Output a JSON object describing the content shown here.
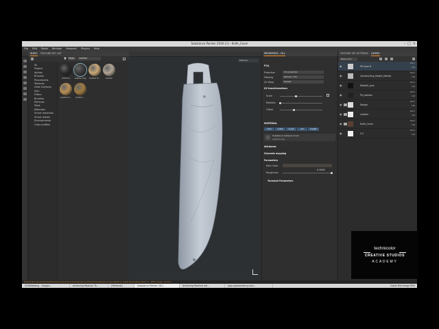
{
  "window": {
    "title": "Substance Painter 2019.3.3 - Knife_Cover"
  },
  "menu": [
    "File",
    "Edit",
    "Mode",
    "Window",
    "Viewport",
    "Plugins",
    "Help"
  ],
  "shelf": {
    "tabs": [
      "SHELF",
      "TEXTURE SET LIST"
    ],
    "filter_chip": "Mate",
    "search_value": "Leather",
    "categories": [
      "All",
      "Project",
      "Alphas",
      "Brushes",
      "Procedurals",
      "Textures",
      "Hard Surfaces",
      "Skin",
      "Filters",
      "Brushes",
      "Particles",
      "Tools",
      "Materials",
      "Smart materials",
      "Smart masks",
      "Environments",
      "Color profiles"
    ],
    "materials": [
      {
        "label": "Artificial",
        "color": "#2a2a2a"
      },
      {
        "label": "Leather bag",
        "color": "#3a3a3a"
      },
      {
        "label": "Leather B...",
        "color": "#c9a979"
      },
      {
        "label": "Leather",
        "color": "#b0a494"
      },
      {
        "label": "Leather R...",
        "color": "#b88f55"
      },
      {
        "label": "Leather ...",
        "color": "#a07a40"
      }
    ]
  },
  "viewport": {
    "mode": "Material"
  },
  "properties": {
    "tab": "PROPERTIES - FILL",
    "fill_label": "FILL",
    "projection_label": "Projection",
    "projection_value": "UV projection",
    "filtering_label": "Filtering",
    "filtering_value": "Bilinear | HQ",
    "uvwrap_label": "UV Wrap",
    "uvwrap_value": "Repeat",
    "uvtrans_label": "UV transformations",
    "scale_label": "Scale",
    "rotation_label": "Rotation",
    "offset_label": "Offset",
    "material_label": "MATERIAL",
    "channels": [
      "color",
      "metal",
      "rough",
      "nrm",
      "height"
    ],
    "substance_mode": "Substance material mode",
    "substance_name": "Leather bag",
    "attributes_label": "Attributes",
    "channels_mapping_label": "Channels mapping",
    "parameters_label": "Parameters",
    "main_color_label": "Main Color",
    "roughness_label": "Roughness",
    "roughness_value": "0.5898",
    "technical_label": "Technical Parameters"
  },
  "layers": {
    "tabs": [
      "TEXTURE SET SETTINGS",
      "LAYERS"
    ],
    "channel_select": "Base Color",
    "rows": [
      {
        "name": "Fill layer 8",
        "blend": "Norm",
        "opacity": "100",
        "thumb": "#cccccc",
        "selected": true
      },
      {
        "name": "Constructing_Height_Details",
        "blend": "Norm",
        "opacity": "100",
        "thumb": "#bbbbbb",
        "selected": false
      },
      {
        "name": "Metallic_pins",
        "blend": "Norm",
        "opacity": "100",
        "thumb": "#111111",
        "selected": false
      },
      {
        "name": "Pin_bottom",
        "blend": "Norm",
        "opacity": "100",
        "thumb": "#222222",
        "selected": false
      },
      {
        "name": "Design",
        "blend": "Norm",
        "opacity": "100",
        "thumb": "#dddddd",
        "selected": false
      },
      {
        "name": "Leather",
        "blend": "Norm",
        "opacity": "100",
        "thumb": "#eeeeee",
        "selected": false
      },
      {
        "name": "Knife_Cover",
        "blend": "Norm",
        "opacity": "100",
        "thumb": "#5a4035",
        "selected": false
      },
      {
        "name": "0.3",
        "blend": "Norm",
        "opacity": "100",
        "thumb": "#f2f2f2",
        "selected": false
      }
    ]
  },
  "status": {
    "text": "[Shell] file:///projects/shelf/Substance/painter/dev/Substance Painter/shelf/resources/substance-materials/Leather.sbsar 1 - GML image: Carrier"
  },
  "taskbar": {
    "items": [
      "GoToMeeting - Google...",
      "Achieving Realism Th...",
      "[Terminal]",
      "Substance Painter 201...",
      "Achieving Realism wit...",
      "[app.gotomeeting.com..."
    ],
    "active_index": 3,
    "tray": "Castle Dist Image  99%"
  },
  "overlay_logo": {
    "line1": "technicolor",
    "line2": "CREATIVE STUDIOS",
    "line3": "ACADEMY"
  }
}
